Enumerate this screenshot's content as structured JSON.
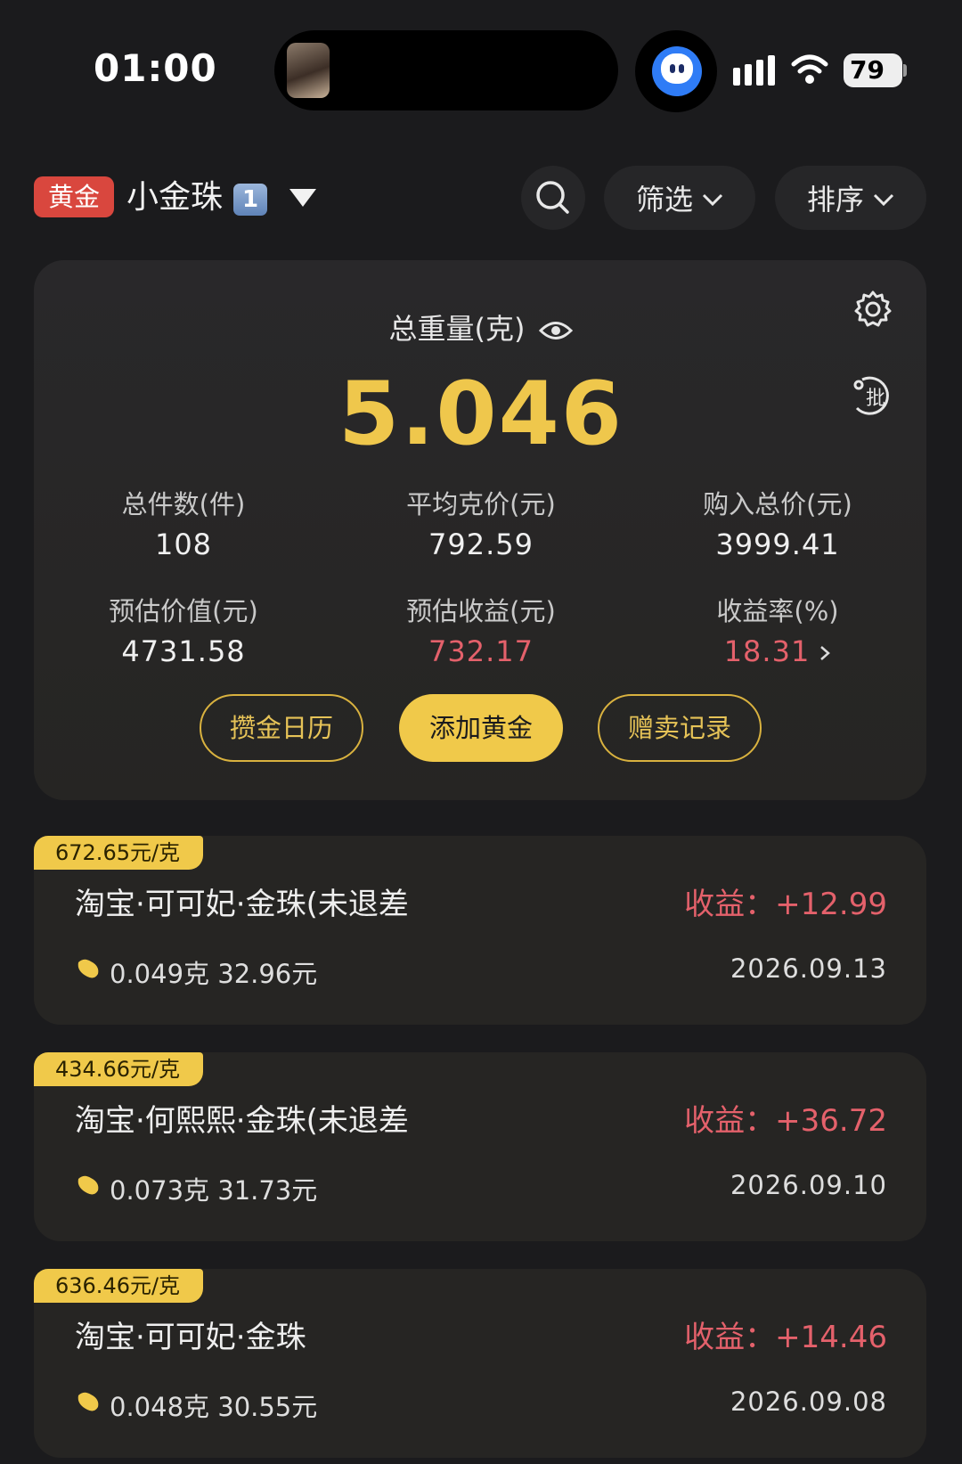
{
  "status_bar": {
    "time": "01:00",
    "battery": "79"
  },
  "header": {
    "tag": "黄金",
    "title": "小金珠",
    "badge": "1",
    "filter_label": "筛选",
    "sort_label": "排序"
  },
  "summary": {
    "title": "总重量(克)",
    "total_weight": "5.046",
    "stats": [
      {
        "label": "总件数(件)",
        "value": "108"
      },
      {
        "label": "平均克价(元)",
        "value": "792.59"
      },
      {
        "label": "购入总价(元)",
        "value": "3999.41"
      },
      {
        "label": "预估价值(元)",
        "value": "4731.58"
      },
      {
        "label": "预估收益(元)",
        "value": "732.17"
      },
      {
        "label": "收益率(%)",
        "value": "18.31"
      }
    ],
    "buttons": {
      "calendar": "攒金日历",
      "add": "添加黄金",
      "records": "赠卖记录"
    },
    "batch_label": "批"
  },
  "items": [
    {
      "price": "672.65元/克",
      "name": "淘宝·可可妃·金珠(未退差",
      "gain": "收益：+12.99",
      "weight_cost": "0.049克 32.96元",
      "date": "2026.09.13"
    },
    {
      "price": "434.66元/克",
      "name": "淘宝·何熙熙·金珠(未退差",
      "gain": "收益：+36.72",
      "weight_cost": "0.073克 31.73元",
      "date": "2026.09.10"
    },
    {
      "price": "636.46元/克",
      "name": "淘宝·可可妃·金珠",
      "gain": "收益：+14.46",
      "weight_cost": "0.048克 30.55元",
      "date": "2026.09.08"
    }
  ],
  "colors": {
    "gold": "#f0c94a",
    "gain_red": "#e4616b",
    "tag_red": "#d9473e",
    "background": "#1b1b1d"
  },
  "icons": [
    "search-icon",
    "chevron-down-icon",
    "eye-icon",
    "gear-icon",
    "batch-icon",
    "gold-bean-icon",
    "signal-icon",
    "wifi-icon"
  ]
}
